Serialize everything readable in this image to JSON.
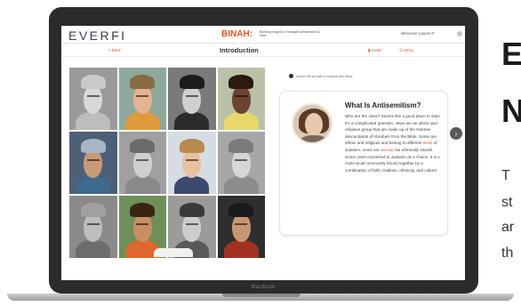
{
  "header": {
    "logo": "EVERFI",
    "product": "BINAH:",
    "product_subtitle": "Building Insights to Navigate Antisemitism & Hate",
    "welcome": "Welcome Lauren F"
  },
  "nav": {
    "back": "< Back",
    "title": "Introduction",
    "listen": "Listen",
    "menu": "Menu"
  },
  "hint": "Select the arrows to explore this story.",
  "card": {
    "title": "What Is Antisemitism?",
    "body_1": "Who are the Jews? Seems like a good place to start. It's a complicated question. Jews are an ethnic and religious group that are made up of the Hebrew descendants of Abraham from the Bible. Some are ethnic and religious and belong to different",
    "highlight_1": "sects",
    "body_2": "of Judaism, some are",
    "highlight_2": "secular",
    "body_3": "but ethnically Jewish. Some Jews converted to Judaism as a choice. It is a multi-racial community bound together by a combination of faith, tradition, ethnicity, and culture."
  },
  "laptop_label": "MacBook",
  "right_text": {
    "heading_1": "E",
    "heading_2": "N",
    "line_1": "T",
    "line_2": "st",
    "line_3": "ar",
    "line_4": "th"
  },
  "colors": {
    "accent": "#e2552a",
    "bezel": "#2b2b2d"
  },
  "photos": [
    {
      "name": "elder-turban",
      "bg": "#9a9a9a",
      "skin": "#d8d8d8",
      "body": "#bdbdbd",
      "hat": "#c9c9c9"
    },
    {
      "name": "smiling-woman-hat",
      "bg": "#8fa89c",
      "skin": "#e4b48f",
      "body": "#e09a3a",
      "hat": "#8a6a44"
    },
    {
      "name": "bearded-man-hat",
      "bg": "#7a7a7a",
      "skin": "#cfcfcf",
      "body": "#2b2b2b",
      "hat": "#1c1c1c"
    },
    {
      "name": "young-man-portrait",
      "bg": "#b9c2a8",
      "skin": "#6b4330",
      "body": "#e8d86a",
      "hat": "#2a1a12"
    },
    {
      "name": "woman-sunglasses",
      "bg": "#4e5f78",
      "skin": "#c79a78",
      "body": "#3d6a8e",
      "hat": "#a9b6c6"
    },
    {
      "name": "woman-basket",
      "bg": "#a0a0a0",
      "skin": "#cfcfcf",
      "body": "#8a8a8a",
      "hat": "#6a6a6a"
    },
    {
      "name": "curly-hair-teen",
      "bg": "#d6dde2",
      "skin": "#e7c2a0",
      "body": "#3b4a6e",
      "hat": "#b88a4e"
    },
    {
      "name": "woman-headwear",
      "bg": "#a7a7a7",
      "skin": "#d6d6d6",
      "body": "#8c8c8c",
      "hat": "#7b7b7b"
    },
    {
      "name": "elder-woman-scarf",
      "bg": "#8a8a8a",
      "skin": "#bdbdbd",
      "body": "#6d6d6d",
      "hat": "#a0a0a0"
    },
    {
      "name": "boy-smiling",
      "bg": "#6e8f5a",
      "skin": "#c98f62",
      "body": "#e0672e",
      "hat": "#3a2414"
    },
    {
      "name": "man-cap",
      "bg": "#9b9b9b",
      "skin": "#cdcdcd",
      "body": "#5a5a5a",
      "hat": "#3a3a3a"
    },
    {
      "name": "girl-glasses",
      "bg": "#2e2e2e",
      "skin": "#c89674",
      "body": "#a1321f",
      "hat": "#1a1a1a"
    }
  ]
}
